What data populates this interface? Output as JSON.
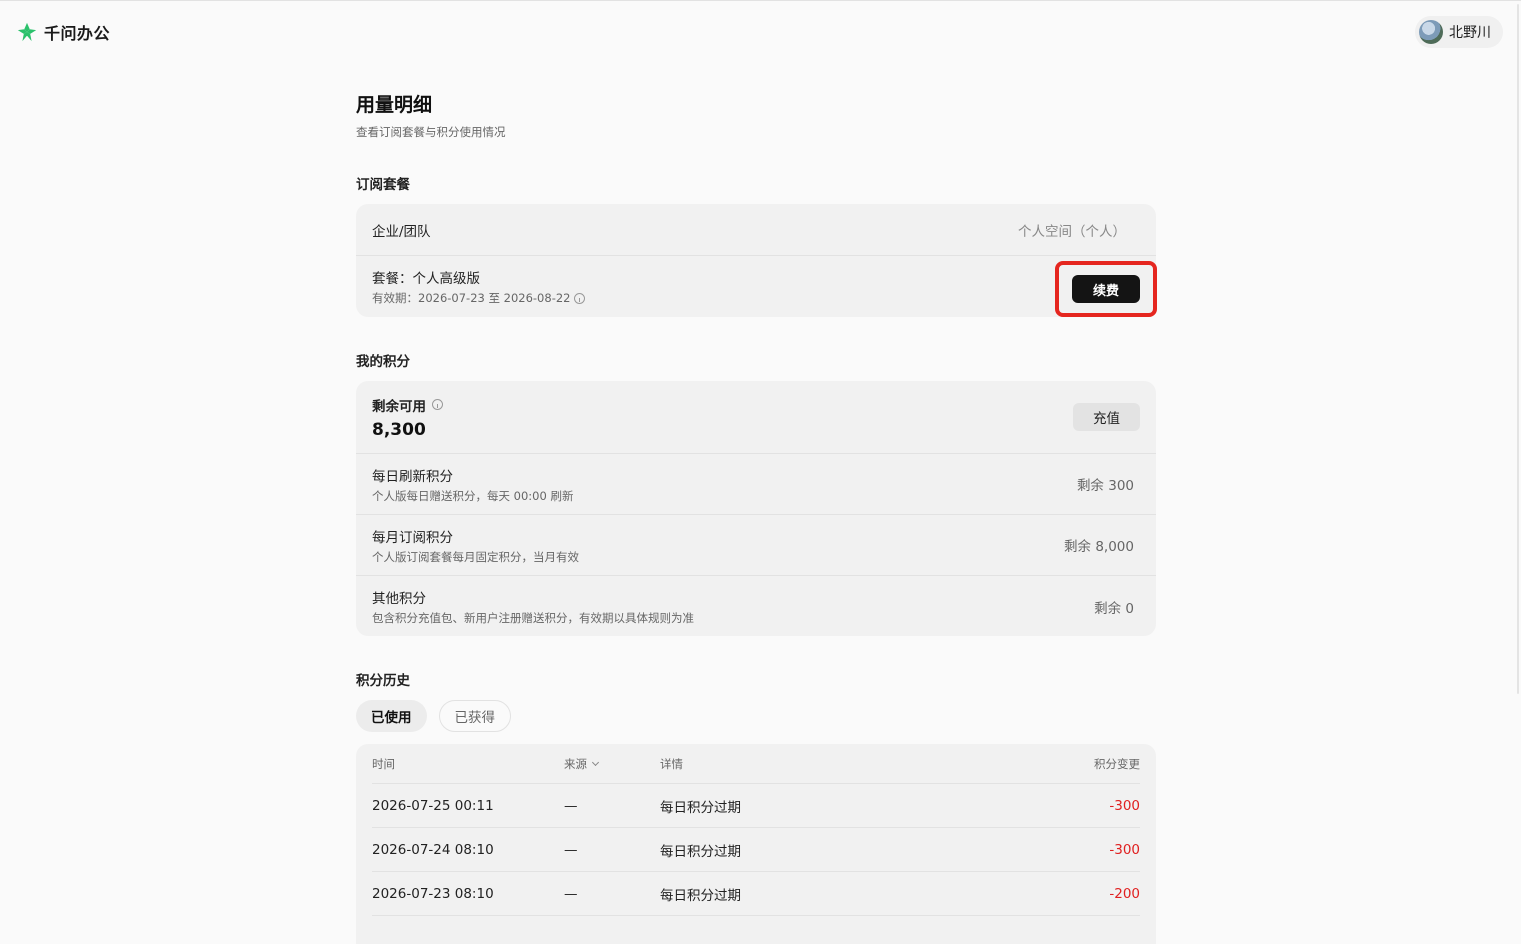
{
  "app": {
    "name": "千问办公"
  },
  "user": {
    "name": "北野川"
  },
  "page": {
    "title": "用量明细",
    "subtitle": "查看订阅套餐与积分使用情况"
  },
  "subscription": {
    "section_title": "订阅套餐",
    "org_label": "企业/团队",
    "space_label": "个人空间（个人）",
    "plan_label": "套餐：个人高级版",
    "valid_label": "有效期：2026-07-23 至 2026-08-22",
    "renew_button": "续费"
  },
  "points": {
    "section_title": "我的积分",
    "available_label": "剩余可用",
    "available_value": "8,300",
    "recharge_button": "充值",
    "items": [
      {
        "name": "每日刷新积分",
        "desc": "个人版每日赠送积分，每天 00:00 刷新",
        "remain": "剩余 300"
      },
      {
        "name": "每月订阅积分",
        "desc": "个人版订阅套餐每月固定积分，当月有效",
        "remain": "剩余 8,000"
      },
      {
        "name": "其他积分",
        "desc": "包含积分充值包、新用户注册赠送积分，有效期以具体规则为准",
        "remain": "剩余 0"
      }
    ]
  },
  "history": {
    "section_title": "积分历史",
    "tabs": [
      {
        "label": "已使用",
        "active": true
      },
      {
        "label": "已获得",
        "active": false
      }
    ],
    "columns": {
      "time": "时间",
      "source": "来源",
      "detail": "详情",
      "change": "积分变更"
    },
    "rows": [
      {
        "time": "2026-07-25 00:11",
        "source": "—",
        "detail": "每日积分过期",
        "change": "-300"
      },
      {
        "time": "2026-07-24 08:10",
        "source": "—",
        "detail": "每日积分过期",
        "change": "-300"
      },
      {
        "time": "2026-07-23 08:10",
        "source": "—",
        "detail": "每日积分过期",
        "change": "-200"
      }
    ]
  },
  "colors": {
    "negative": "#e02020",
    "highlight": "#e5261f",
    "logo": "#2bc16b"
  }
}
